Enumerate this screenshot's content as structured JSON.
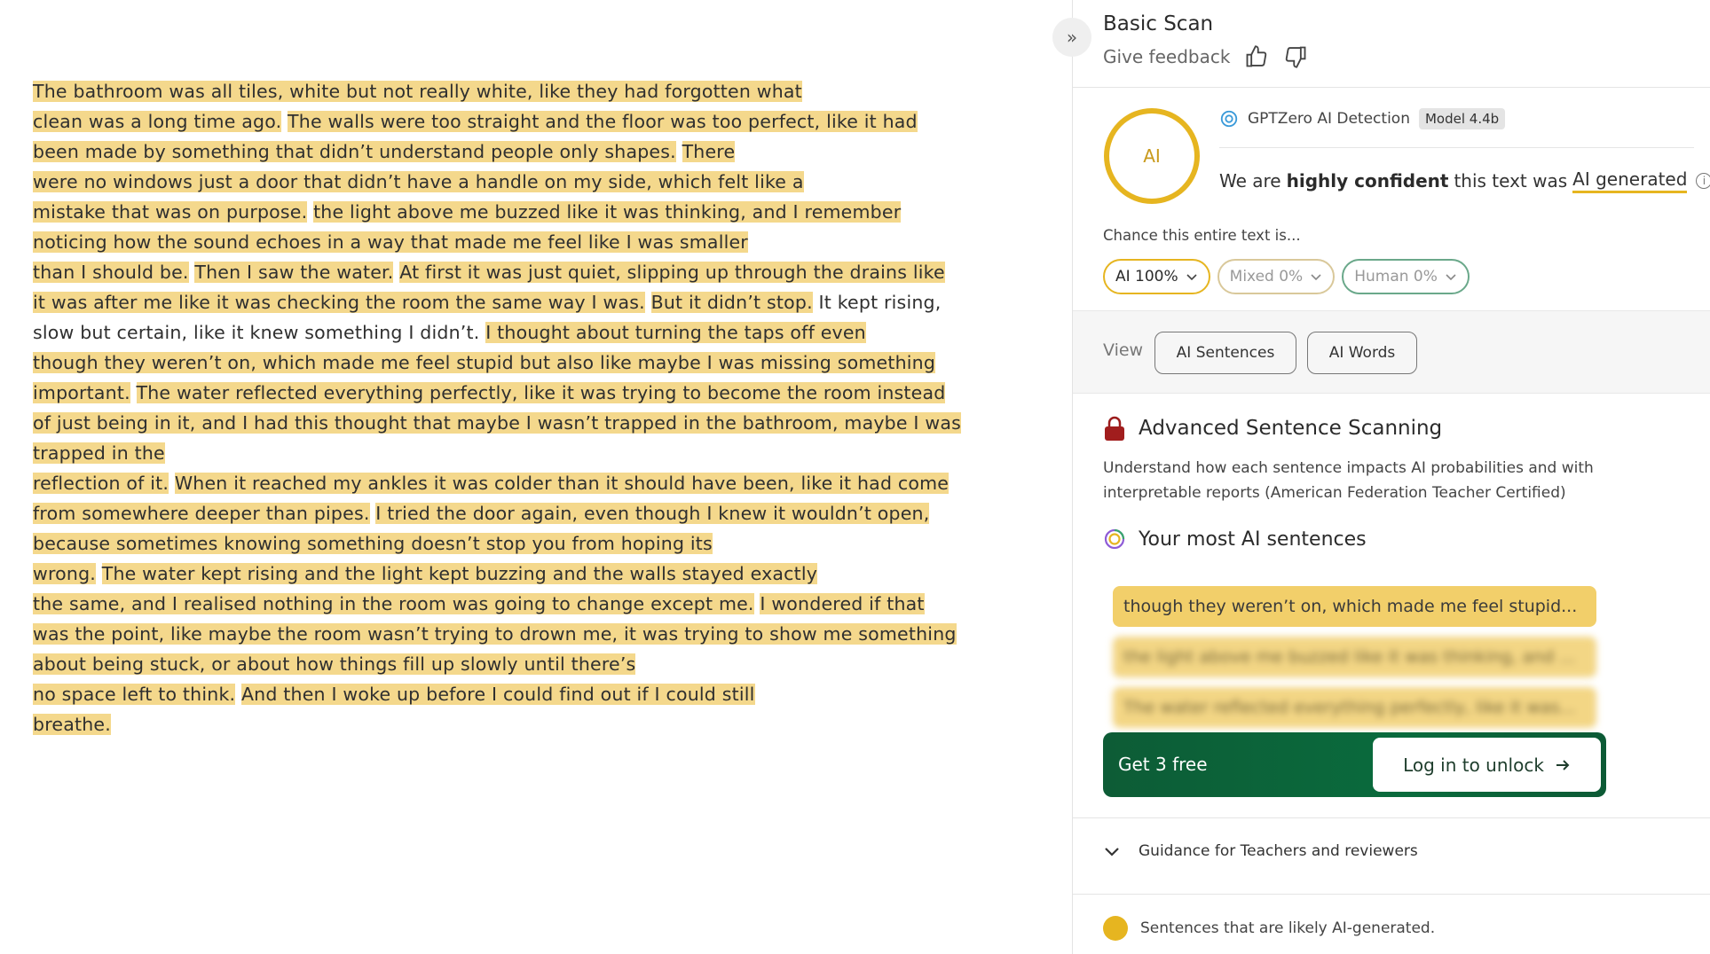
{
  "document": {
    "lines": [
      [
        {
          "t": "The bathroom was all tiles, white but not really white, like they had forgotten what",
          "h": true
        }
      ],
      [
        {
          "t": "clean was a long time ago.",
          "h": true
        },
        {
          "t": " ",
          "h": false
        },
        {
          "t": "The walls were too straight and the floor was too perfect, like it had ",
          "h": true
        }
      ],
      [
        {
          "t": "been made by something that didn’t understand people only shapes.",
          "h": true
        },
        {
          "t": " ",
          "h": false
        },
        {
          "t": "There",
          "h": true
        }
      ],
      [
        {
          "t": "were no windows just a door that didn’t have a handle on my side, which felt like a",
          "h": true
        }
      ],
      [
        {
          "t": "mistake that was on purpose.",
          "h": true
        },
        {
          "t": " ",
          "h": false
        },
        {
          "t": "the light above me buzzed like it was thinking, and I remember ",
          "h": true
        }
      ],
      [
        {
          "t": "noticing how the sound echoes in a way that made me feel like I was smaller",
          "h": true
        }
      ],
      [
        {
          "t": "than I should be.",
          "h": true
        },
        {
          "t": " ",
          "h": false
        },
        {
          "t": "Then I saw the water.",
          "h": true
        },
        {
          "t": " ",
          "h": false
        },
        {
          "t": "At first it was just quiet, slipping up through the drains like ",
          "h": true
        }
      ],
      [
        {
          "t": "it was after me like it was checking the room the same way I was.",
          "h": true
        },
        {
          "t": " ",
          "h": false
        },
        {
          "t": "But it didn’t stop.",
          "h": true
        },
        {
          "t": " It kept rising,",
          "h": false
        }
      ],
      [
        {
          "t": "slow but certain, like it knew something I didn’t. ",
          "h": false
        },
        {
          "t": "I thought about turning the taps off even",
          "h": true
        }
      ],
      [
        {
          "t": "though they weren’t on, which made me feel stupid but also like maybe I was missing something ",
          "h": true
        }
      ],
      [
        {
          "t": "important.",
          "h": true
        },
        {
          "t": " ",
          "h": false
        },
        {
          "t": "The water reflected everything perfectly, like it was trying to become the room instead ",
          "h": true
        }
      ],
      [
        {
          "t": "of just being in it, and I had this thought that maybe I wasn’t trapped in the bathroom, maybe I was ",
          "h": true
        }
      ],
      [
        {
          "t": "trapped in the",
          "h": true
        }
      ],
      [
        {
          "t": "reflection of it.",
          "h": true
        },
        {
          "t": " ",
          "h": false
        },
        {
          "t": "When it reached my ankles it was colder than it should have been, like it had come ",
          "h": true
        }
      ],
      [
        {
          "t": "from somewhere deeper than pipes.",
          "h": true
        },
        {
          "t": " ",
          "h": false
        },
        {
          "t": "I tried the door again, even though I knew it wouldn’t open, ",
          "h": true
        }
      ],
      [
        {
          "t": "because sometimes knowing something doesn’t stop you from hoping its",
          "h": true
        }
      ],
      [
        {
          "t": "wrong.",
          "h": true
        },
        {
          "t": " ",
          "h": false
        },
        {
          "t": "The water kept rising and the light kept buzzing and the walls stayed exactly",
          "h": true
        }
      ],
      [
        {
          "t": "the same, and I realised nothing in the room was going to change except me.",
          "h": true
        },
        {
          "t": " ",
          "h": false
        },
        {
          "t": "I wondered if that ",
          "h": true
        }
      ],
      [
        {
          "t": "was the point, like maybe the room wasn’t trying to drown me, it was trying to show me something ",
          "h": true
        }
      ],
      [
        {
          "t": "about being stuck, or about how things fill up slowly until there’s",
          "h": true
        }
      ],
      [
        {
          "t": "no space left to think.",
          "h": true
        },
        {
          "t": " ",
          "h": false
        },
        {
          "t": "And then I woke up before I could find out if I could still",
          "h": true
        }
      ],
      [
        {
          "t": "breathe.",
          "h": true
        }
      ]
    ]
  },
  "panel": {
    "title": "Basic Scan",
    "feedback_label": "Give feedback",
    "score_label": "AI",
    "detector_name": "GPTZero AI Detection",
    "model_badge": "Model 4.4b",
    "verdict_prefix": "We are",
    "verdict_strong": "highly confident",
    "verdict_middle": "this text was",
    "verdict_result": "AI generated",
    "chance_label": "Chance this entire text is...",
    "pills": {
      "ai": "AI 100%",
      "mixed": "Mixed 0%",
      "human": "Human 0%"
    },
    "view_label": "View",
    "view_ai_sentences": "AI Sentences",
    "view_ai_words": "AI Words",
    "advanced_title": "Advanced Sentence Scanning",
    "advanced_desc": "Understand how each sentence impacts AI probabilities and with interpretable reports (American Federation Teacher Certified)",
    "most_ai_title": "Your most AI sentences",
    "top_sentences": [
      "though they weren’t on, which made me feel stupid...",
      "the light above me buzzed like it was thinking, and ...",
      "The water reflected everything perfectly, like it was..."
    ],
    "get_free": "Get 3 free",
    "login_unlock": "Log in to unlock",
    "guidance": "Guidance for Teachers and reviewers",
    "legend_ai": "Sentences that are likely AI-generated."
  },
  "colors": {
    "highlight": "#f4d88c",
    "accent": "#e6b520",
    "green": "#0a6b3d"
  }
}
